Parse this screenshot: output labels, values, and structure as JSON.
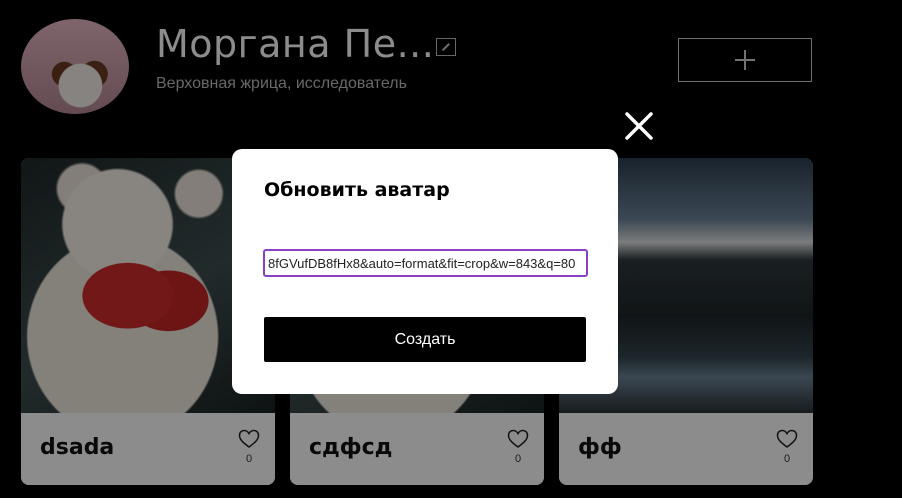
{
  "profile": {
    "name": "Моргана Пе...",
    "role": "Верховная жрица, исследователь"
  },
  "header": {
    "edit_icon": "pencil-icon",
    "add_icon": "plus-icon"
  },
  "cards": [
    {
      "title": "dsada",
      "likes": "0"
    },
    {
      "title": "сдфсд",
      "likes": "0"
    },
    {
      "title": "фф",
      "likes": "0"
    }
  ],
  "modal": {
    "title": "Обновить аватар",
    "url_value": "8fGVufDB8fHx8&auto=format&fit=crop&w=843&q=80",
    "submit_label": "Создать",
    "close_icon": "close-icon"
  },
  "colors": {
    "background": "#000000",
    "input_focus_border": "#8b3fc6",
    "submit_bg": "#000000"
  }
}
